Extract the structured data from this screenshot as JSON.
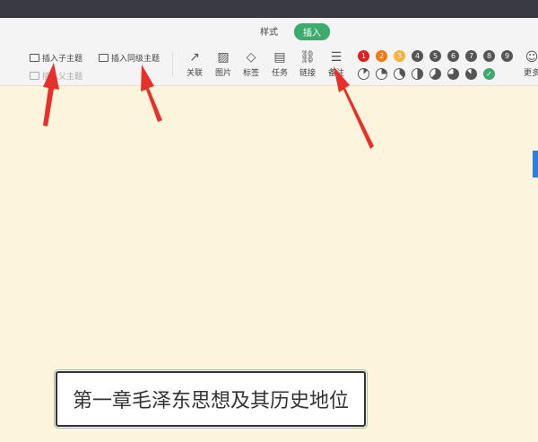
{
  "tabs": [
    {
      "label": "样式"
    },
    {
      "label": "插入",
      "active": true
    }
  ],
  "insert": {
    "child": "插入子主题",
    "sibling": "插入同级主题",
    "parent": "插入父主题"
  },
  "tools": [
    {
      "label": "关联",
      "icon": "arrow-icon"
    },
    {
      "label": "图片",
      "icon": "image-icon"
    },
    {
      "label": "标签",
      "icon": "tag-icon"
    },
    {
      "label": "任务",
      "icon": "task-icon"
    },
    {
      "label": "链接",
      "icon": "link-icon"
    },
    {
      "label": "备注",
      "icon": "note-icon"
    }
  ],
  "priorities": [
    "1",
    "2",
    "3",
    "4",
    "5",
    "6",
    "7",
    "8",
    "9"
  ],
  "priority_colors": [
    "#e02020",
    "#f07a10",
    "#f5b23c",
    "#555555",
    "#555555",
    "#555555",
    "#555555",
    "#555555",
    "#555555"
  ],
  "progress": [
    0.125,
    0.25,
    0.375,
    0.5,
    0.625,
    0.75,
    0.875,
    1
  ],
  "more": "更多",
  "topic": "第一章毛泽东思想及其历史地位",
  "accent": "#3daa6e"
}
